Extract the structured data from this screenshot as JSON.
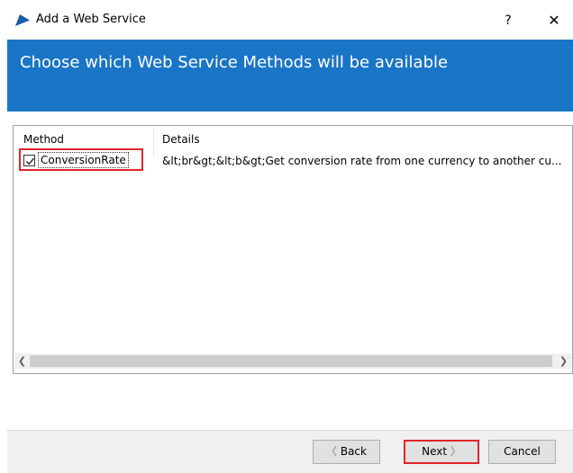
{
  "window": {
    "title": "Add a Web Service",
    "help_label": "?",
    "close_label": "✕"
  },
  "banner": {
    "title": "Choose which Web Service Methods will be available",
    "color": "#1a75c7"
  },
  "methods_list": {
    "columns": [
      "Method",
      "Details"
    ],
    "rows": [
      {
        "checked": true,
        "method": "ConversionRate",
        "details": "&lt;br&gt;&lt;b&gt;Get conversion rate from one currency to another cu..."
      }
    ]
  },
  "buttons": {
    "back": "Back",
    "back_chevron": "〈",
    "next": "Next",
    "next_chevron": "〉",
    "cancel": "Cancel"
  },
  "scrollbar": {
    "left_arrow": "❮",
    "right_arrow": "❯"
  },
  "highlight_color": "#e0242b"
}
